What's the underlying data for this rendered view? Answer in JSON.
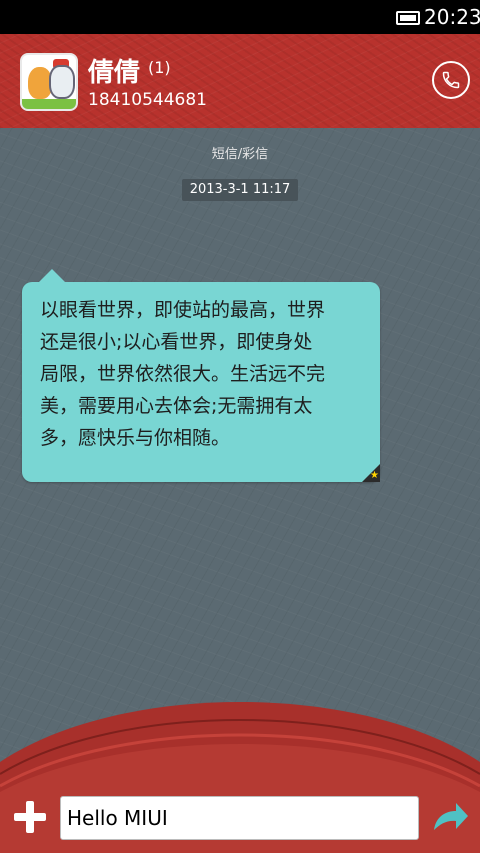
{
  "status_bar": {
    "time": "20:23",
    "battery_icon": "battery-icon"
  },
  "header": {
    "contact_name": "倩倩",
    "unread_count": "(1)",
    "phone_number": "18410544681",
    "avatar_icon": "cartoon-avatar",
    "call_icon": "phone-icon"
  },
  "conversation": {
    "message_type": "短信/彩信",
    "timestamp": "2013-3-1 11:17",
    "messages": [
      {
        "lines": [
          "以眼看世界，即使站的最高，世界",
          "还是很小;以心看世界，即使身处",
          "局限，世界依然很大。生活远不完",
          "美，需要用心去体会;无需拥有太",
          "多，愿快乐与你相随。"
        ],
        "starred": true,
        "bubble_color": "#79d6d3"
      }
    ]
  },
  "compose": {
    "value": "Hello MIUI",
    "add_icon": "plus-icon",
    "send_icon": "send-arrow-icon"
  },
  "colors": {
    "header_red": "#b8322d",
    "background_slate": "#5b6a72",
    "accent_teal": "#4fc1c4"
  }
}
